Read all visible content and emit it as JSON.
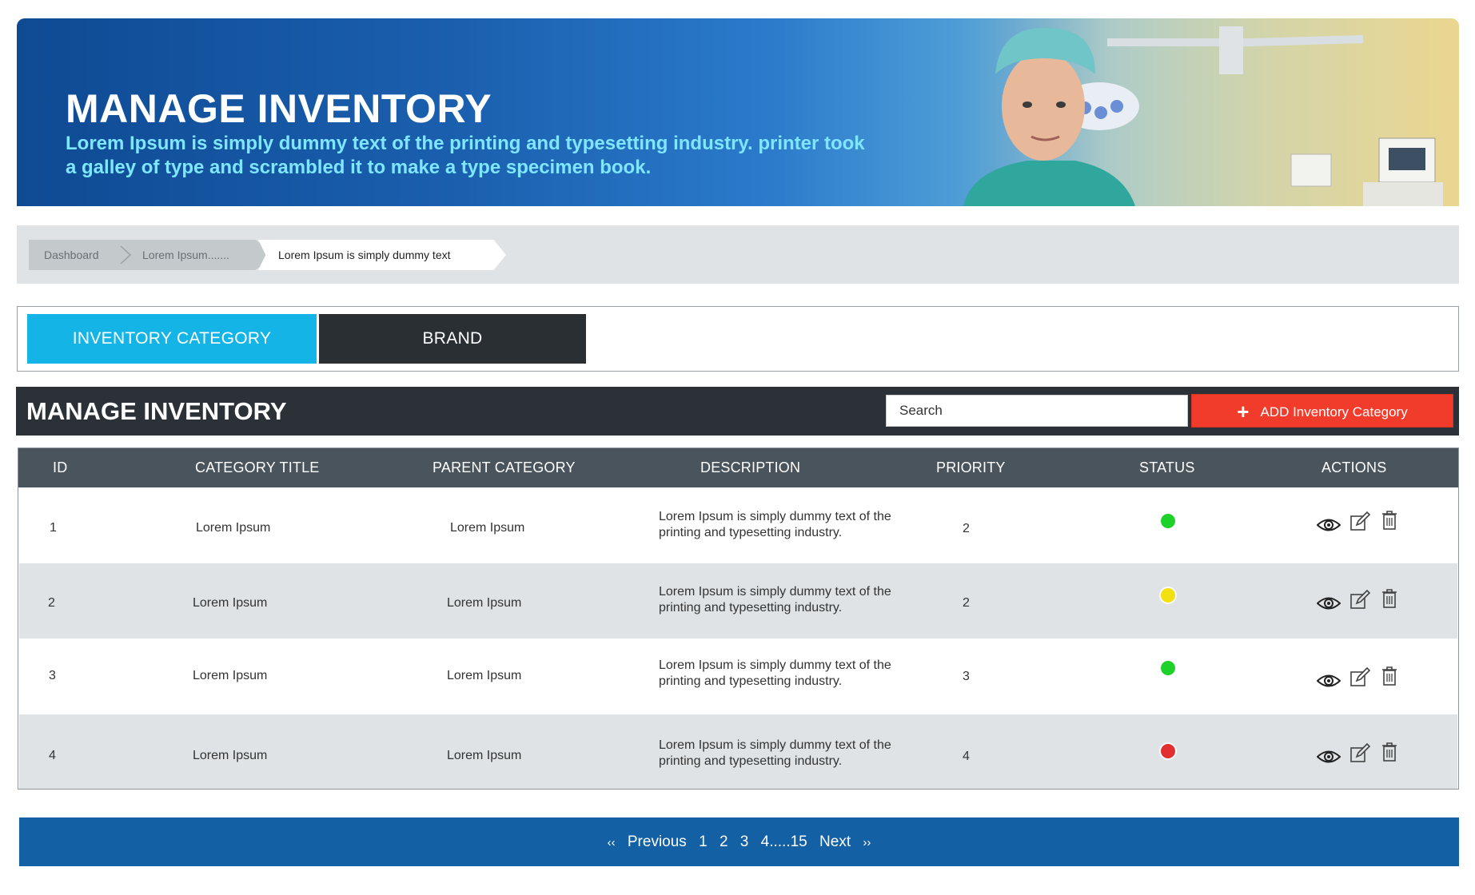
{
  "banner": {
    "title": "MANAGE INVENTORY",
    "subtitle": "Lorem Ipsum is simply dummy text of the printing and typesetting industry. printer took a galley of type and scrambled it to make a type specimen book."
  },
  "breadcrumb": [
    "Dashboard",
    "Lorem Ipsum.......",
    "Lorem Ipsum is simply dummy text"
  ],
  "tabs": [
    {
      "label": "INVENTORY CATEGORY",
      "active": true
    },
    {
      "label": "BRAND",
      "active": false
    }
  ],
  "manage": {
    "title": "MANAGE INVENTORY",
    "search_placeholder": "Search",
    "add_label": "ADD Inventory Category"
  },
  "table": {
    "columns": [
      "ID",
      "CATEGORY TITLE",
      "PARENT CATEGORY",
      "DESCRIPTION",
      "PRIORITY",
      "STATUS",
      "ACTIONS"
    ],
    "rows": [
      {
        "id": "1",
        "title": "Lorem Ipsum",
        "parent": "Lorem Ipsum",
        "description": "Lorem Ipsum is simply dummy text of the printing and typesetting industry.",
        "priority": "2",
        "status": "green"
      },
      {
        "id": "2",
        "title": "Lorem Ipsum",
        "parent": "Lorem Ipsum",
        "description": "Lorem Ipsum is simply dummy text of the printing and typesetting industry.",
        "priority": "2",
        "status": "yellow"
      },
      {
        "id": "3",
        "title": "Lorem Ipsum",
        "parent": "Lorem Ipsum",
        "description": "Lorem Ipsum is simply dummy text of the printing and typesetting industry.",
        "priority": "3",
        "status": "green"
      },
      {
        "id": "4",
        "title": "Lorem Ipsum",
        "parent": "Lorem Ipsum",
        "description": "Lorem Ipsum is simply dummy text of the printing and typesetting industry.",
        "priority": "4",
        "status": "red"
      }
    ],
    "actions": [
      "eye-icon",
      "edit-icon",
      "trash-icon"
    ]
  },
  "status_colors": {
    "green": "#1ed12a",
    "yellow": "#f2e011",
    "red": "#e13030"
  },
  "pager": {
    "prev_arrow": "‹‹",
    "previous": "Previous",
    "pages": [
      "1",
      "2",
      "3",
      "4.....15"
    ],
    "next": "Next",
    "next_arrow": "››"
  }
}
